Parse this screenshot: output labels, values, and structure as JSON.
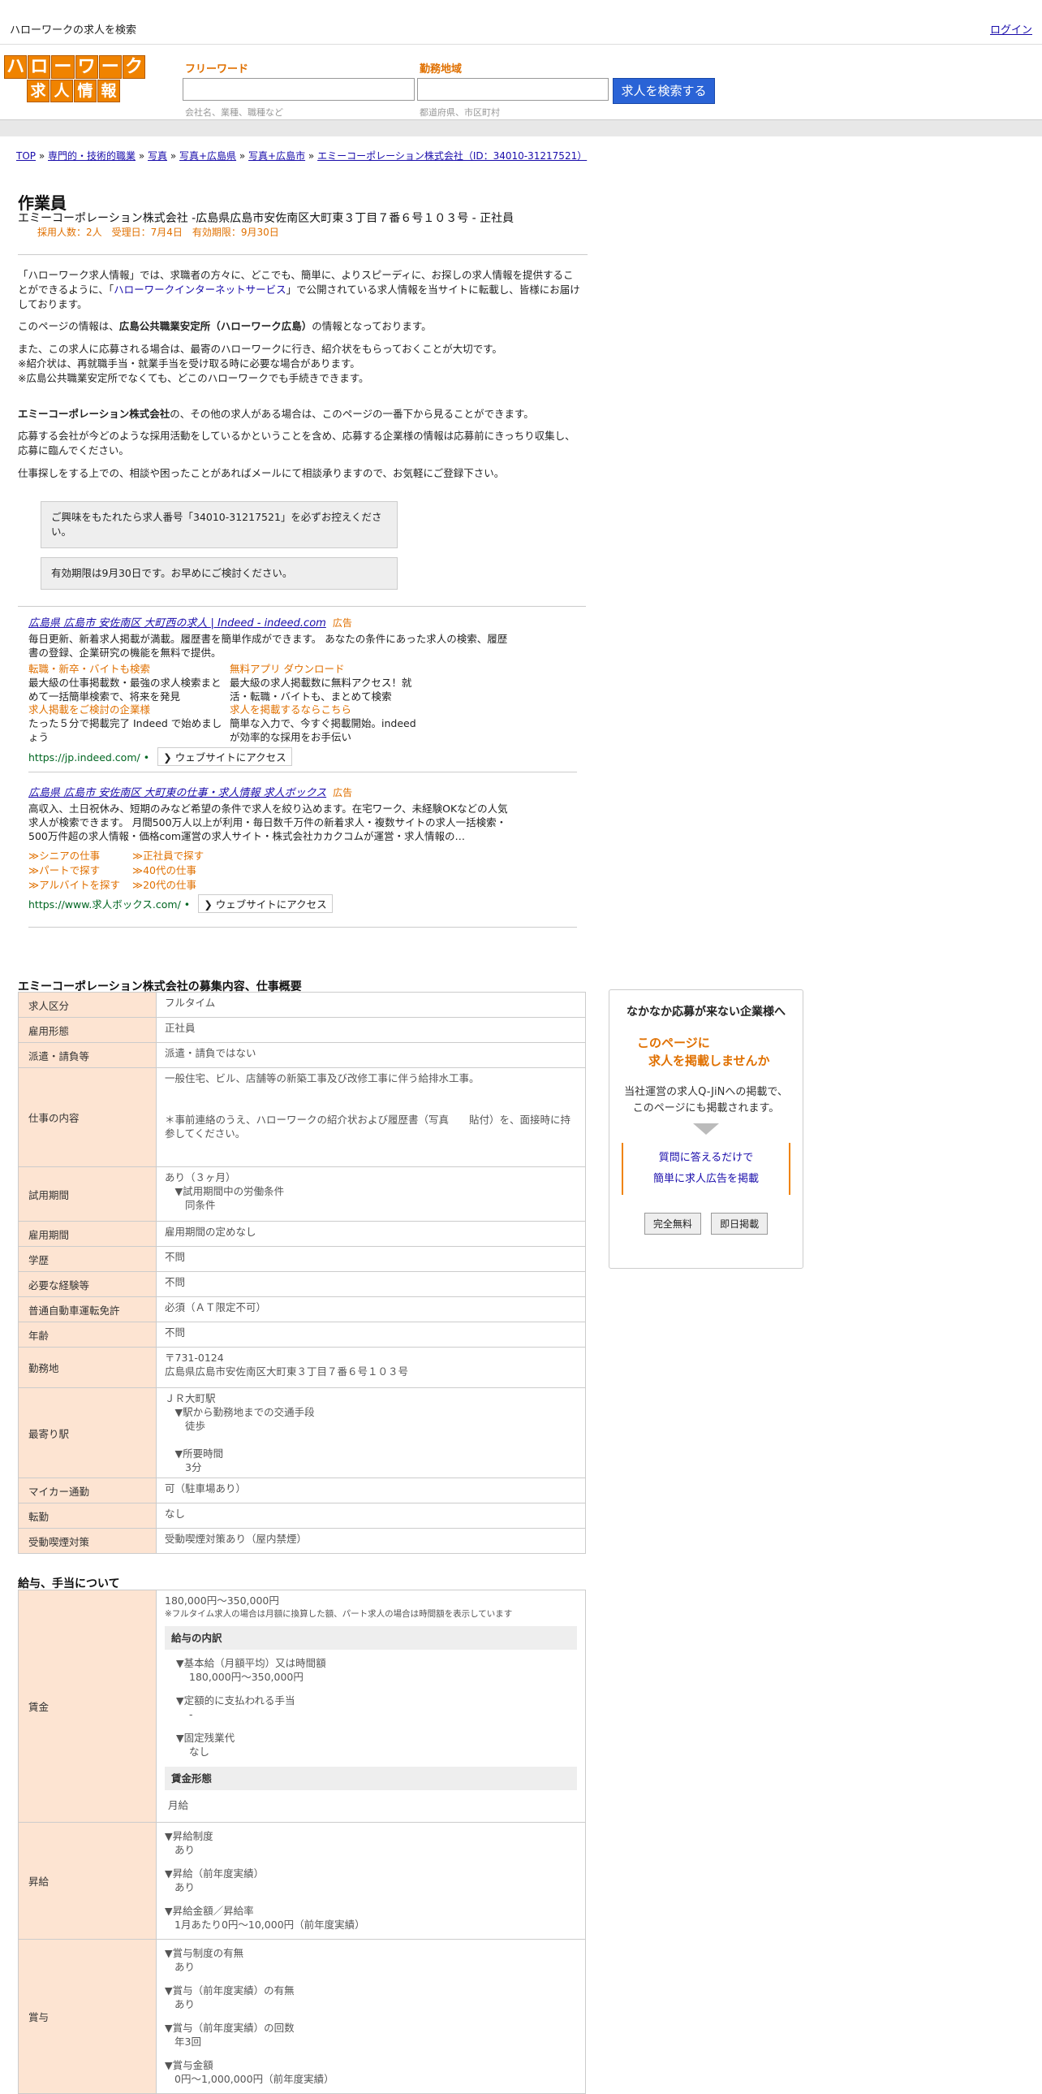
{
  "topbar": {
    "site_label": "ハローワークの求人を検索",
    "login": "ログイン"
  },
  "logo": {
    "row1": [
      "ハ",
      "ロ",
      "ー",
      "ワ",
      "ー",
      "ク"
    ],
    "row2": [
      "求",
      "人",
      "情",
      "報"
    ]
  },
  "search": {
    "keyword_label": "フリーワード",
    "keyword_hint": "会社名、業種、職種など",
    "location_label": "勤務地域",
    "location_hint": "都道府県、市区町村",
    "button": "求人を検索する"
  },
  "breadcrumb": {
    "items": [
      "TOP",
      "専門的・技術的職業",
      "写真",
      "写真+広島県",
      "写真+広島市",
      "エミーコーポレーション株式会社（ID：34010-31217521）"
    ],
    "sep": " » "
  },
  "job": {
    "title": "作業員",
    "subtitle": "エミーコーポレーション株式会社 -広島県広島市安佐南区大町東３丁目７番６号１０３号 - 正社員",
    "meta": "採用人数：2人　受理日：7月4日　有効期限：9月30日"
  },
  "intro": {
    "p1_a": "「ハローワーク求人情報」では、求職者の方々に、どこでも、簡単に、よりスピーディに、お探しの求人情報を提供することができるように、「",
    "p1_link": "ハローワークインターネットサービス",
    "p1_b": "」で公開されている求人情報を当サイトに転載し、皆様にお届けしております。",
    "p2_a": "このページの情報は、",
    "p2_bold": "広島公共職業安定所（ハローワーク広島）",
    "p2_b": "の情報となっております。",
    "p3_1": "また、この求人に応募される場合は、最寄のハローワークに行き、紹介状をもらっておくことが大切です。",
    "p3_2": "※紹介状は、再就職手当・就業手当を受け取る時に必要な場合があります。",
    "p3_3": "※広島公共職業安定所でなくても、どこのハローワークでも手続きできます。",
    "p4_bold": "エミーコーポレーション株式会社",
    "p4_b": "の、その他の求人がある場合は、このページの一番下から見ることができます。",
    "p5": "応募する会社が今どのような採用活動をしているかということを含め、応募する企業様の情報は応募前にきっちり収集し、応募に臨んでください。",
    "p6": "仕事探しをする上での、相談や困ったことがあればメールにて相談承りますので、お気軽にご登録下さい。",
    "box1": "ご興味をもたれたら求人番号「34010-31217521」を必ずお控えください。",
    "box2": "有効期限は9月30日です。お早めにご検討ください。"
  },
  "ads": [
    {
      "title": "広島県 広島市 安佐南区 大町西の求人 | Indeed - indeed.com",
      "badge": "広告",
      "text": "毎日更新、新着求人掲載が満載。履歴書を簡単作成ができます。 あなたの条件にあった求人の検索、履歴書の登録、企業研究の機能を無料で提供。",
      "subs": [
        {
          "h": "転職・新卒・バイトも検索",
          "t": "最大級の仕事掲載数・最強の求人検索まとめて一括簡単検索で、将来を発見"
        },
        {
          "h": "無料アプリ ダウンロード",
          "t": "最大級の求人掲載数に無料アクセス！就活・転職・バイトも、まとめて検索"
        },
        {
          "h": "求人掲載をご検討の企業様",
          "t": "たった５分で掲載完了 Indeed で始めましょう"
        },
        {
          "h": "求人を掲載するならこちら",
          "t": "簡単な入力で、今すぐ掲載開始。indeedが効率的な採用をお手伝い"
        }
      ],
      "url": "https://jp.indeed.com/",
      "visit": "ウェブサイトにアクセス"
    },
    {
      "title": "広島県 広島市 安佐南区 大町東の仕事・求人情報 求人ボックス",
      "badge": "広告",
      "text": "高収入、土日祝休み、短期のみなど希望の条件で求人を絞り込めます。在宅ワーク、未経験OKなどの人気求人が検索できます。 月間500万人以上が利用・毎日数千万件の新着求人・複数サイトの求人一括検索・500万件超の求人情報・価格com運営の求人サイト・株式会社カカクコムが運営・求人情報の…",
      "links": [
        "≫シニアの仕事",
        "≫正社員で探す",
        "≫パートで探す",
        "≫40代の仕事",
        "≫アルバイトを探す",
        "≫20代の仕事"
      ],
      "url": "https://www.求人ボックス.com/",
      "visit": "ウェブサイトにアクセス"
    }
  ],
  "overview": {
    "heading": "エミーコーポレーション株式会社の募集内容、仕事概要",
    "rows": [
      {
        "k": "求人区分",
        "v": "フルタイム"
      },
      {
        "k": "雇用形態",
        "v": "正社員"
      },
      {
        "k": "派遣・請負等",
        "v": "派遣・請負ではない"
      },
      {
        "k": "仕事の内容",
        "v": "一般住宅、ビル、店舗等の新築工事及び改修工事に伴う給排水工事。\n\n\n＊事前連絡のうえ、ハローワークの紹介状および履歴書（写真　　貼付）を、面接時に持参してください。"
      },
      {
        "k": "試用期間",
        "v": "あり（３ヶ月）\n　▼試用期間中の労働条件\n　　同条件"
      },
      {
        "k": "雇用期間",
        "v": "雇用期間の定めなし"
      },
      {
        "k": "学歴",
        "v": "不問"
      },
      {
        "k": "必要な経験等",
        "v": "不問"
      },
      {
        "k": "普通自動車運転免許",
        "v": "必須（ＡＴ限定不可）"
      },
      {
        "k": "年齢",
        "v": "不問"
      },
      {
        "k": "勤務地",
        "v": "〒731-0124\n広島県広島市安佐南区大町東３丁目７番６号１０３号"
      },
      {
        "k": "最寄り駅",
        "v": "ＪＲ大町駅\n　▼駅から勤務地までの交通手段\n　　徒歩\n\n　▼所要時間\n　　3分"
      },
      {
        "k": "マイカー通勤",
        "v": "可（駐車場あり）"
      },
      {
        "k": "転勤",
        "v": "なし"
      },
      {
        "k": "受動喫煙対策",
        "v": "受動喫煙対策あり（屋内禁煙）"
      }
    ]
  },
  "salary": {
    "heading": "給与、手当について",
    "wage_label": "賃金",
    "wage_range": "180,000円〜350,000円",
    "wage_note": "※フルタイム求人の場合は月額に換算した額、パート求人の場合は時間額を表示しています",
    "breakdown_h": "給与の内訳",
    "base_label": "▼基本給（月額平均）又は時間額",
    "base_value": "180,000円〜350,000円",
    "fixed_allow_label": "▼定額的に支払われる手当",
    "fixed_allow_value": "-",
    "fixed_ot_label": "▼固定残業代",
    "fixed_ot_value": "なし",
    "form_h": "賃金形態",
    "form_value": "月給",
    "raise_label": "昇給",
    "raise_items": [
      {
        "h": "▼昇給制度",
        "v": "あり"
      },
      {
        "h": "▼昇給（前年度実績）",
        "v": "あり"
      },
      {
        "h": "▼昇給金額／昇給率",
        "v": "1月あたり0円〜10,000円（前年度実績）"
      }
    ],
    "bonus_label": "賞与",
    "bonus_items": [
      {
        "h": "▼賞与制度の有無",
        "v": "あり"
      },
      {
        "h": "▼賞与（前年度実績）の有無",
        "v": "あり"
      },
      {
        "h": "▼賞与（前年度実績）の回数",
        "v": "年3回"
      },
      {
        "h": "▼賞与金額",
        "v": "0円〜1,000,000円（前年度実績）"
      }
    ]
  },
  "sidebox": {
    "title": "なかなか応募が来ない企業様へ",
    "offer_1": "このページに",
    "offer_2": "求人を掲載しませんか",
    "desc": "当社運営の求人Q-JiNへの掲載で、このページにも掲載されます。",
    "link1": "質問に答えるだけで",
    "link2": "簡単に求人広告を掲載",
    "btn_free": "完全無料",
    "btn_now": "即日掲載"
  }
}
